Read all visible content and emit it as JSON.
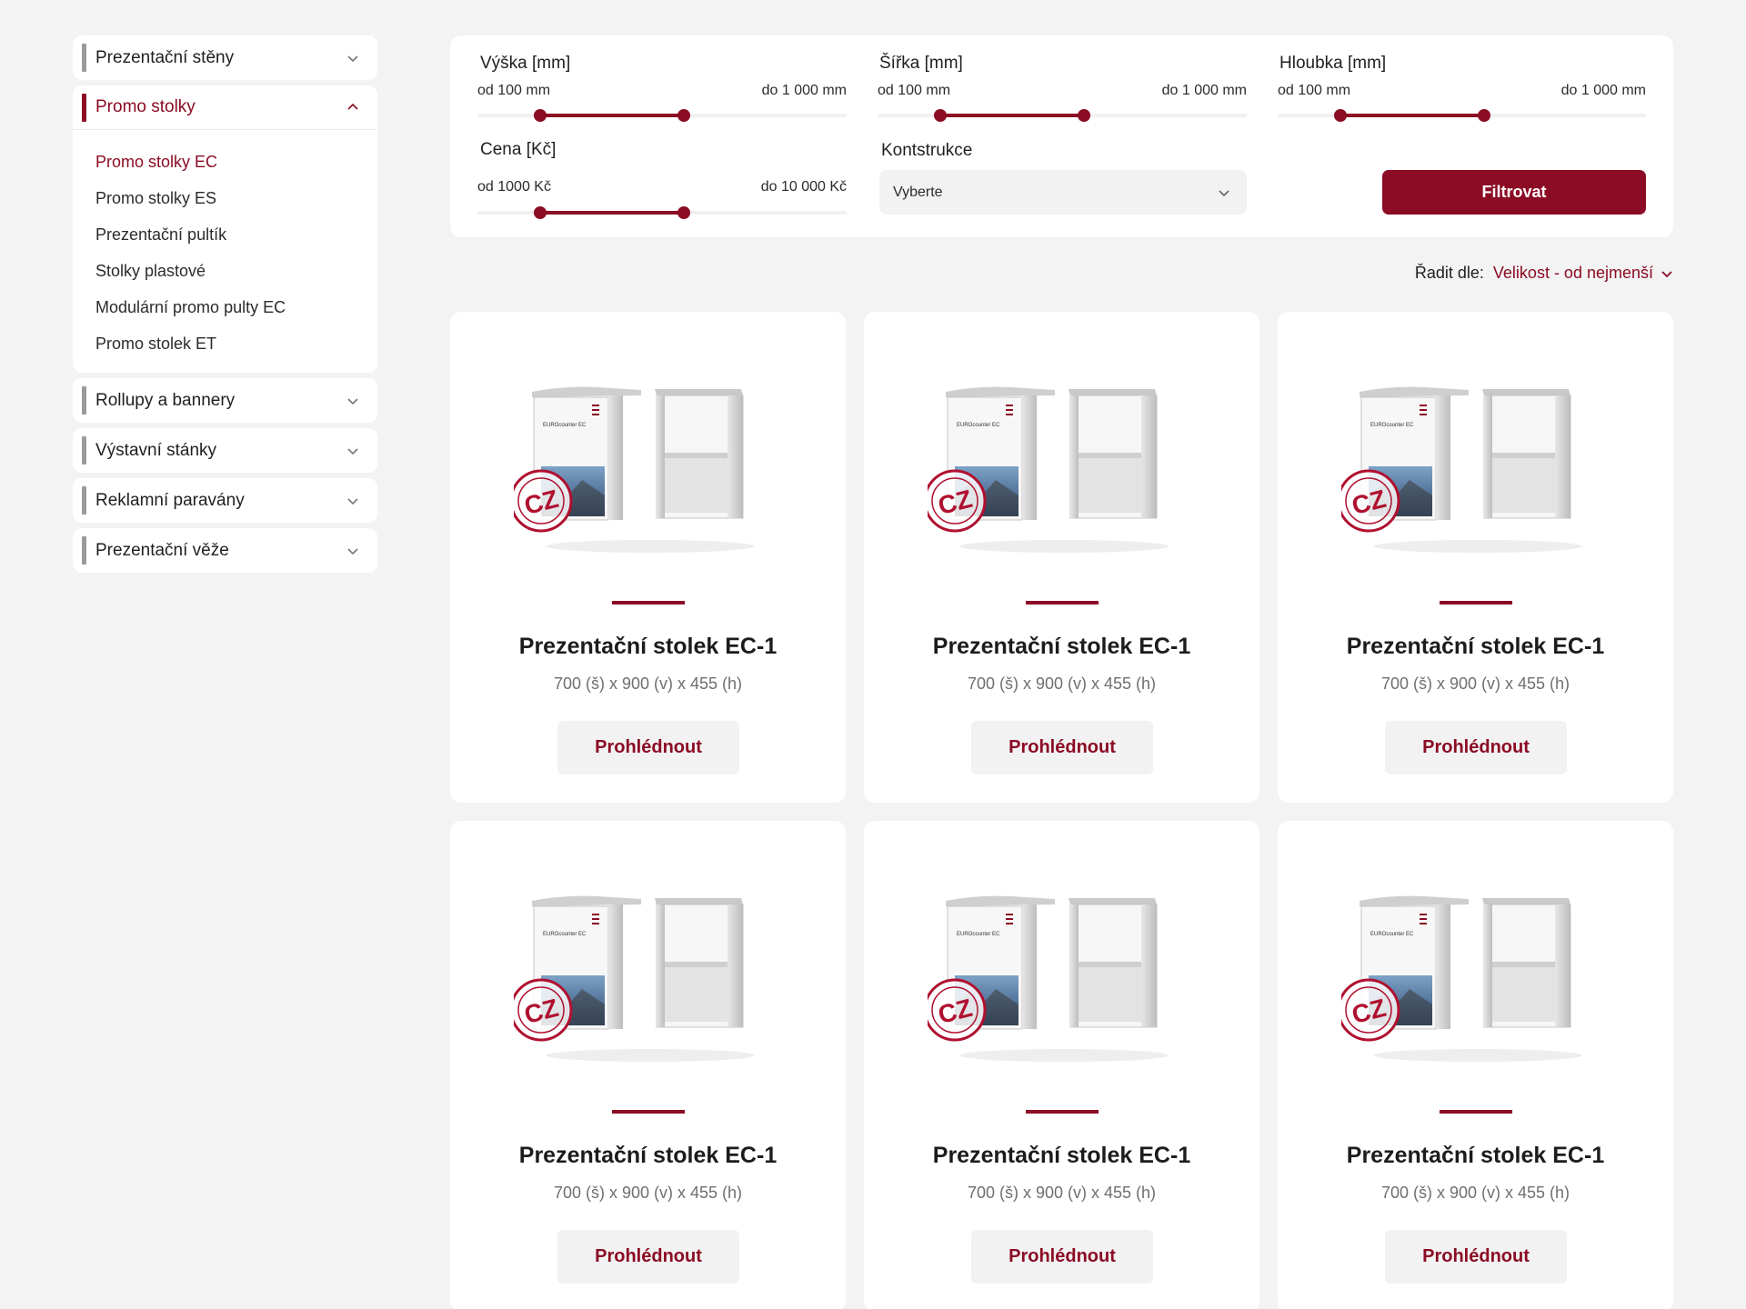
{
  "sidebar": {
    "categories": [
      {
        "label": "Prezentační stěny",
        "open": false
      },
      {
        "label": "Promo stolky",
        "open": true,
        "items": [
          "Promo stolky EC",
          "Promo stolky ES",
          "Prezentační pultík",
          "Stolky plastové",
          "Modulární promo pulty EC",
          "Promo stolek ET"
        ]
      },
      {
        "label": "Rollupy a bannery",
        "open": false
      },
      {
        "label": "Výstavní stánky",
        "open": false
      },
      {
        "label": "Reklamní paravány",
        "open": false
      },
      {
        "label": "Prezentační věže",
        "open": false
      }
    ],
    "active_item": "Promo stolky EC"
  },
  "filter": {
    "height": {
      "title": "Výška [mm]",
      "from_label": "od 100 mm",
      "to_label": "do 1 000 mm",
      "from_value": 0.17,
      "to_value": 0.56
    },
    "width": {
      "title": "Šířka [mm]",
      "from_label": "od 100 mm",
      "to_label": "do 1 000 mm",
      "from_value": 0.17,
      "to_value": 0.56
    },
    "depth": {
      "title": "Hloubka [mm]",
      "from_label": "od 100 mm",
      "to_label": "do 1 000 mm",
      "from_value": 0.17,
      "to_value": 0.56
    },
    "price": {
      "title": "Cena [Kč]",
      "from_label": "od 1000 Kč",
      "to_label": "do 10 000 Kč",
      "from_value": 0.17,
      "to_value": 0.56
    },
    "construction": {
      "title": "Kontstrukce",
      "value": "Vyberte"
    },
    "submit_label": "Filtrovat"
  },
  "sort": {
    "label": "Řadit dle:",
    "value": "Velikost - od nejmenší"
  },
  "products": [
    {
      "title": "Prezentační stolek EC-1",
      "dims": "700 (š) x 900 (v) x 455 (h)",
      "button": "Prohlédnout"
    },
    {
      "title": "Prezentační stolek EC-1",
      "dims": "700 (š) x 900 (v) x 455 (h)",
      "button": "Prohlédnout"
    },
    {
      "title": "Prezentační stolek EC-1",
      "dims": "700 (š) x 900 (v) x 455 (h)",
      "button": "Prohlédnout"
    },
    {
      "title": "Prezentační stolek EC-1",
      "dims": "700 (š) x 900 (v) x 455 (h)",
      "button": "Prohlédnout"
    },
    {
      "title": "Prezentační stolek EC-1",
      "dims": "700 (š) x 900 (v) x 455 (h)",
      "button": "Prohlédnout"
    },
    {
      "title": "Prezentační stolek EC-1",
      "dims": "700 (š) x 900 (v) x 455 (h)",
      "button": "Prohlédnout"
    }
  ],
  "product_image": {
    "stamp_text": "CZ",
    "panel_brand": "EUROcounter EC"
  },
  "colors": {
    "accent": "#8b0c24",
    "background": "#f3f3f3",
    "card": "#ffffff"
  }
}
